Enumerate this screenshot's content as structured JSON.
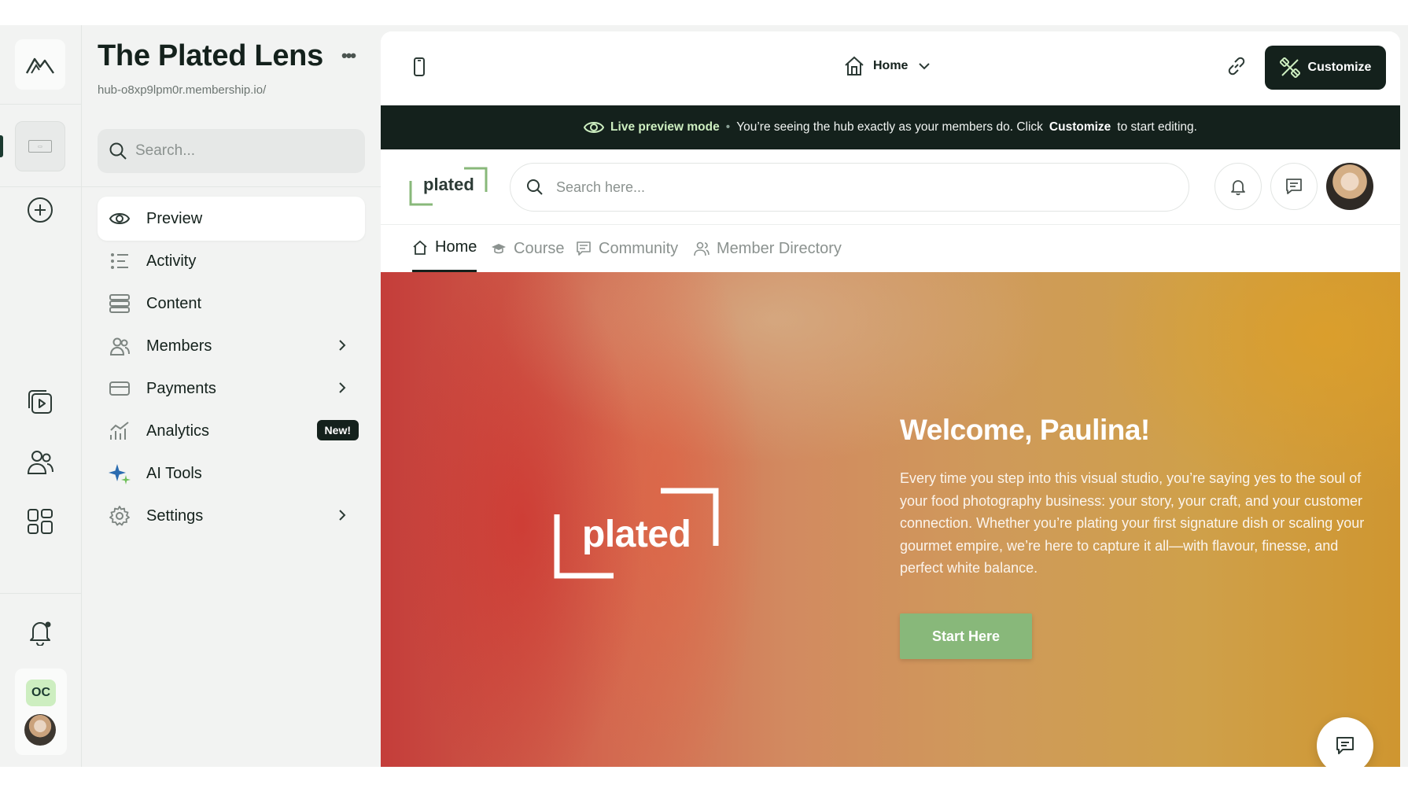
{
  "rail": {
    "items": [
      {
        "icon": "mountain-logo-icon"
      },
      {
        "icon": "hub-thumbnail-icon"
      },
      {
        "icon": "add-circle-icon"
      },
      {
        "icon": "video-library-icon"
      },
      {
        "icon": "people-icon"
      },
      {
        "icon": "apps-grid-icon"
      },
      {
        "icon": "notification-bell-icon"
      }
    ],
    "org_initials": "OC"
  },
  "sidebar": {
    "title": "The Plated Lens",
    "url": "hub-o8xp9lpm0r.membership.io/",
    "search_placeholder": "Search...",
    "items": [
      {
        "label": "Preview",
        "icon": "eye-icon",
        "active": true
      },
      {
        "label": "Activity",
        "icon": "activity-list-icon"
      },
      {
        "label": "Content",
        "icon": "content-stack-icon"
      },
      {
        "label": "Members",
        "icon": "members-icon",
        "has_children": true
      },
      {
        "label": "Payments",
        "icon": "credit-card-icon",
        "has_children": true
      },
      {
        "label": "Analytics",
        "icon": "analytics-chart-icon",
        "badge": "New!"
      },
      {
        "label": "AI Tools",
        "icon": "sparkle-icon"
      },
      {
        "label": "Settings",
        "icon": "gear-icon",
        "has_children": true
      }
    ]
  },
  "toolbar": {
    "page_selector": "Home",
    "customize_label": "Customize"
  },
  "banner": {
    "lead": "Live preview mode",
    "text_before": "You’re seeing the hub exactly as your members do. Click",
    "emphasis": "Customize",
    "text_after": "to start editing."
  },
  "hub": {
    "logo_text": "plated",
    "search_placeholder": "Search here...",
    "tabs": [
      {
        "label": "Home",
        "icon": "home-icon",
        "active": true
      },
      {
        "label": "Course",
        "icon": "graduation-cap-icon"
      },
      {
        "label": "Community",
        "icon": "chat-icon"
      },
      {
        "label": "Member Directory",
        "icon": "member-directory-icon"
      }
    ],
    "hero": {
      "logo_text": "plated",
      "title": "Welcome, Paulina!",
      "body": "Every time you step into this visual studio, you’re saying yes to the soul of your food photography business: your story, your craft, and your customer connection. Whether you’re plating your first signature dish or scaling your gourmet empire, we’re here to capture it all—with flavour, finesse, and perfect white balance.",
      "cta": "Start Here"
    }
  },
  "colors": {
    "brand_dark": "#14211c",
    "accent_green": "#cdeec0",
    "cta_green": "#88b87a"
  }
}
